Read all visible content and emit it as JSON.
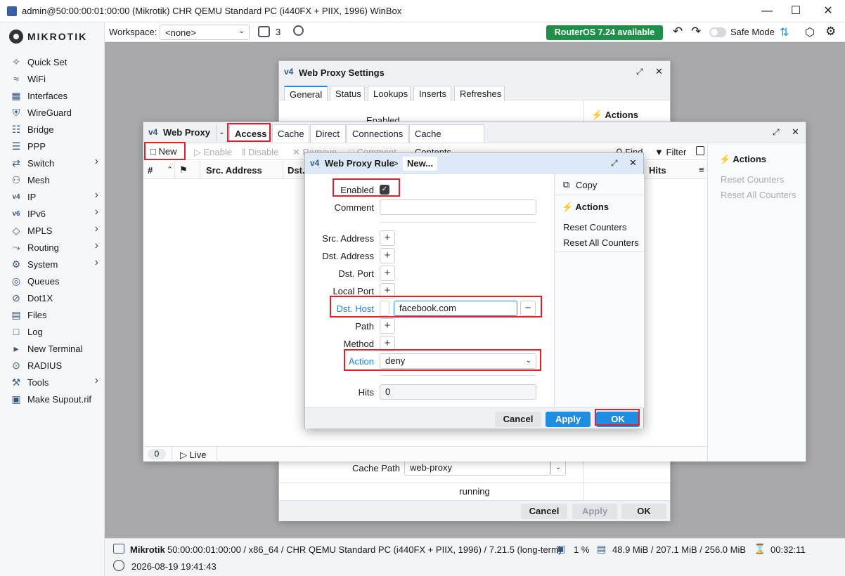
{
  "window": {
    "title": "admin@50:00:00:01:00:00 (Mikrotik) CHR QEMU Standard PC (i440FX + PIIX, 1996) WinBox"
  },
  "brand": "MIKROTIK",
  "sidebar": {
    "items": [
      {
        "label": "Quick Set",
        "icon": "wand-icon",
        "chev": false
      },
      {
        "label": "WiFi",
        "icon": "wifi-icon",
        "chev": false
      },
      {
        "label": "Interfaces",
        "icon": "interfaces-icon",
        "chev": false
      },
      {
        "label": "WireGuard",
        "icon": "wireguard-icon",
        "chev": false
      },
      {
        "label": "Bridge",
        "icon": "bridge-icon",
        "chev": false
      },
      {
        "label": "PPP",
        "icon": "ppp-icon",
        "chev": false
      },
      {
        "label": "Switch",
        "icon": "switch-icon",
        "chev": true
      },
      {
        "label": "Mesh",
        "icon": "mesh-icon",
        "chev": false
      },
      {
        "label": "IP",
        "icon": "ipv4-icon",
        "chev": true
      },
      {
        "label": "IPv6",
        "icon": "ipv6-icon",
        "chev": true
      },
      {
        "label": "MPLS",
        "icon": "mpls-icon",
        "chev": true
      },
      {
        "label": "Routing",
        "icon": "routing-icon",
        "chev": true
      },
      {
        "label": "System",
        "icon": "gear-icon",
        "chev": true
      },
      {
        "label": "Queues",
        "icon": "queues-icon",
        "chev": false
      },
      {
        "label": "Dot1X",
        "icon": "dot1x-icon",
        "chev": false
      },
      {
        "label": "Files",
        "icon": "files-icon",
        "chev": false
      },
      {
        "label": "Log",
        "icon": "log-icon",
        "chev": false
      },
      {
        "label": "New Terminal",
        "icon": "terminal-icon",
        "chev": false
      },
      {
        "label": "RADIUS",
        "icon": "radius-icon",
        "chev": false
      },
      {
        "label": "Tools",
        "icon": "tools-icon",
        "chev": true
      },
      {
        "label": "Make Supout.rif",
        "icon": "supout-icon",
        "chev": false
      }
    ]
  },
  "topbar": {
    "workspace_label": "Workspace:",
    "workspace_value": "<none>",
    "windows_count": "3",
    "update_badge": "RouterOS 7.24 available",
    "safe_mode": "Safe Mode"
  },
  "proxy_settings": {
    "title": "Web Proxy Settings",
    "tabs": [
      "General",
      "Status",
      "Lookups",
      "Inserts",
      "Refreshes"
    ],
    "enabled_label": "Enabled",
    "actions_label": "Actions",
    "cache_path_label": "Cache Path",
    "cache_path_value": "web-proxy",
    "status_text": "running",
    "cancel": "Cancel",
    "apply": "Apply",
    "ok": "OK"
  },
  "proxy_list": {
    "title": "Web Proxy",
    "tabs": [
      "Access",
      "Cache",
      "Direct",
      "Connections",
      "Cache Contents"
    ],
    "toolbar": {
      "new": "New",
      "enable": "Enable",
      "disable": "Disable",
      "remove": "Remove",
      "comment": "Comment",
      "find": "Find",
      "filter": "Filter"
    },
    "columns": [
      "#",
      "Src. Address",
      "Dst.",
      "Hits"
    ],
    "count": "0",
    "live": "Live",
    "actions_label": "Actions",
    "reset_counters": "Reset Counters",
    "reset_all": "Reset All Counters"
  },
  "rule": {
    "title": "Web Proxy Rule",
    "crumb": "New...",
    "enabled_label": "Enabled",
    "comment_label": "Comment",
    "comment_value": "",
    "src_address": "Src. Address",
    "dst_address": "Dst. Address",
    "dst_port": "Dst. Port",
    "local_port": "Local Port",
    "dst_host_label": "Dst. Host",
    "dst_host_value": "facebook.com",
    "path": "Path",
    "method": "Method",
    "action_label": "Action",
    "action_value": "deny",
    "hits_label": "Hits",
    "hits_value": "0",
    "copy": "Copy",
    "actions_label": "Actions",
    "reset_counters": "Reset Counters",
    "reset_all": "Reset All Counters",
    "cancel": "Cancel",
    "apply": "Apply",
    "ok": "OK"
  },
  "status": {
    "identity": "Mikrotik",
    "details": "50:00:00:01:00:00 / x86_64 / CHR QEMU Standard PC (i440FX + PIIX, 1996) / 7.21.5 (long-term)",
    "cpu": "1 %",
    "memory": "48.9 MiB / 207.1 MiB / 256.0 MiB",
    "uptime": "00:32:11",
    "datetime": "2026-08-19 19:41:43"
  },
  "colors": {
    "accent": "#1f8de0",
    "update": "#1f8f4a",
    "highlight": "#e0202a",
    "label_blue": "#2a7fd6"
  }
}
